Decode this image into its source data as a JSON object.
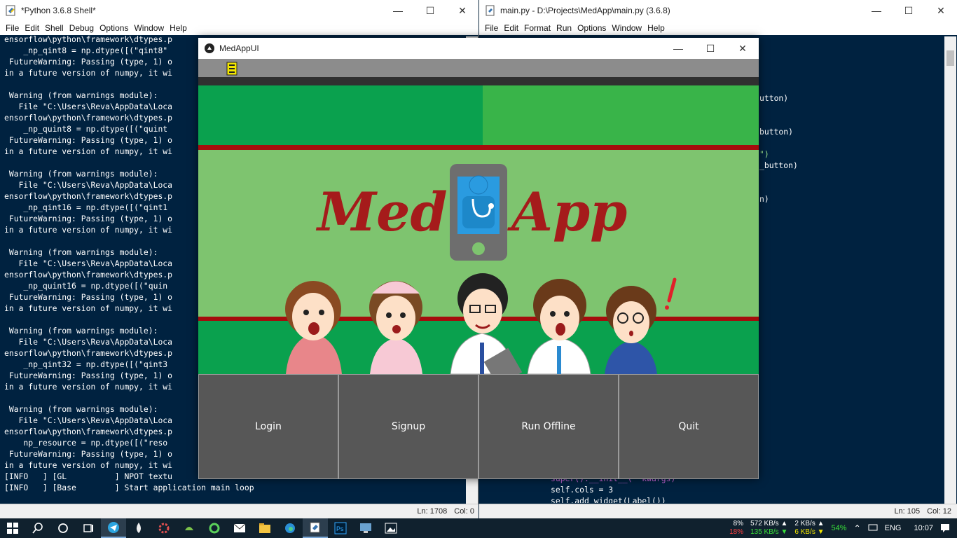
{
  "shell": {
    "title": "*Python 3.6.8 Shell*",
    "menu": [
      "File",
      "Edit",
      "Shell",
      "Debug",
      "Options",
      "Window",
      "Help"
    ],
    "lines": [
      "ensorflow\\python\\framework\\dtypes.p",
      "    _np_qint8 = np.dtype([(\"qint8\"",
      " FutureWarning: Passing (type, 1) o",
      "in a future version of numpy, it wi",
      "",
      " Warning (from warnings module):",
      "   File \"C:\\Users\\Reva\\AppData\\Loca",
      "ensorflow\\python\\framework\\dtypes.p",
      "    _np_quint8 = np.dtype([(\"quint",
      " FutureWarning: Passing (type, 1) o",
      "in a future version of numpy, it wi",
      "",
      " Warning (from warnings module):",
      "   File \"C:\\Users\\Reva\\AppData\\Loca",
      "ensorflow\\python\\framework\\dtypes.p",
      "    _np_qint16 = np.dtype([(\"qint1",
      " FutureWarning: Passing (type, 1) o",
      "in a future version of numpy, it wi",
      "",
      " Warning (from warnings module):",
      "   File \"C:\\Users\\Reva\\AppData\\Loca",
      "ensorflow\\python\\framework\\dtypes.p",
      "    _np_quint16 = np.dtype([(\"quin",
      " FutureWarning: Passing (type, 1) o",
      "in a future version of numpy, it wi",
      "",
      " Warning (from warnings module):",
      "   File \"C:\\Users\\Reva\\AppData\\Loca",
      "ensorflow\\python\\framework\\dtypes.p",
      "    _np_qint32 = np.dtype([(\"qint3",
      " FutureWarning: Passing (type, 1) o",
      "in a future version of numpy, it wi",
      "",
      " Warning (from warnings module):",
      "   File \"C:\\Users\\Reva\\AppData\\Loca",
      "ensorflow\\python\\framework\\dtypes.p",
      "    np_resource = np.dtype([(\"reso",
      " FutureWarning: Passing (type, 1) o",
      "in a future version of numpy, it wi",
      "[INFO   ] [GL          ] NPOT textu",
      "[INFO   ] [Base        ] Start application main loop"
    ],
    "status_ln": "Ln: 1708",
    "status_col": "Col: 0"
  },
  "editor": {
    "title": "main.py - D:\\Projects\\MedApp\\main.py (3.6.8)",
    "menu": [
      "File",
      "Edit",
      "Format",
      "Run",
      "Options",
      "Window",
      "Help"
    ],
    "visible_fragments": [
      "utton)",
      "button)",
      "\")",
      "_button)",
      "n)"
    ],
    "bottom_lines": [
      "super().__init__(**kwargs)",
      "self.cols = 3",
      "self.add_widget(Label())"
    ],
    "status_ln": "Ln: 105",
    "status_col": "Col: 12"
  },
  "kivy": {
    "title": "MedAppUI",
    "logo_word_left": "Med",
    "logo_word_right": "App",
    "buttons": [
      "Login",
      "Signup",
      "Run Offline",
      "Quit"
    ]
  },
  "taskbar": {
    "cpu": "8%",
    "cpu2": "18%",
    "net_up": "572 KB/s",
    "net_down": "135 KB/s",
    "disk_up": "2 KB/s",
    "disk_down": "6 KB/s",
    "battery": "54%",
    "lang": "ENG",
    "time": "10:07"
  },
  "colors": {
    "shell_bg": "#002240",
    "kivy_green_dark": "#0aa14e",
    "kivy_green_light": "#7ec46f",
    "kivy_red_line": "#a50d0d",
    "logo_red": "#a51b1b",
    "button_bg": "#575757"
  }
}
